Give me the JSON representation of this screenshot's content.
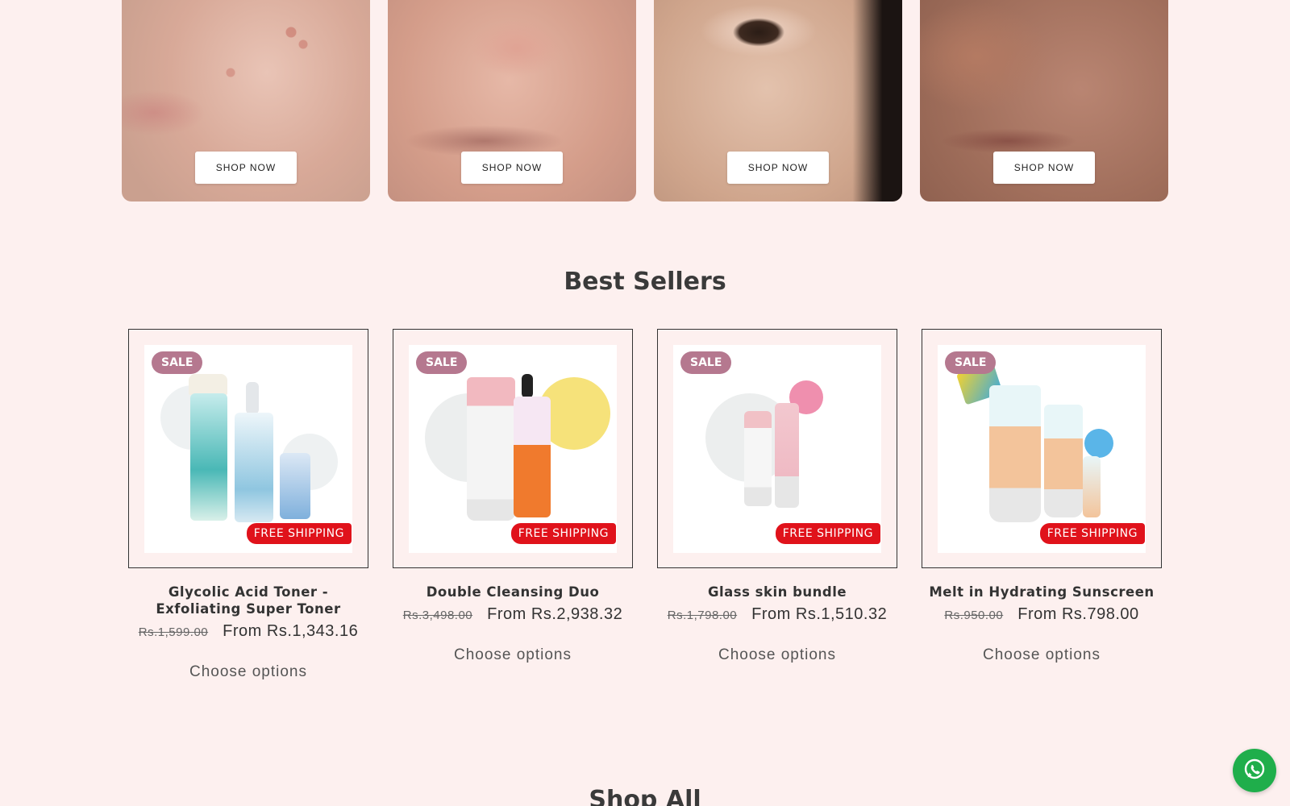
{
  "hero_tiles": [
    {
      "button_label": "SHOP NOW"
    },
    {
      "button_label": "SHOP NOW"
    },
    {
      "button_label": "SHOP NOW"
    },
    {
      "button_label": "SHOP NOW"
    }
  ],
  "best_sellers": {
    "title": "Best Sellers",
    "products": [
      {
        "badge": "SALE",
        "shipping_label": "FREE SHIPPING",
        "title": "Glycolic Acid Toner - Exfoliating Super Toner",
        "price_old": "Rs.1,599.00",
        "price_new": "From Rs.1,343.16",
        "action_label": "Choose options"
      },
      {
        "badge": "SALE",
        "shipping_label": "FREE SHIPPING",
        "title": "Double Cleansing Duo",
        "price_old": "Rs.3,498.00",
        "price_new": "From Rs.2,938.32",
        "action_label": "Choose options"
      },
      {
        "badge": "SALE",
        "shipping_label": "FREE SHIPPING",
        "title": "Glass skin bundle",
        "price_old": "Rs.1,798.00",
        "price_new": "From Rs.1,510.32",
        "action_label": "Choose options"
      },
      {
        "badge": "SALE",
        "shipping_label": "FREE SHIPPING",
        "title": "Melt in Hydrating Sunscreen",
        "price_old": "Rs.950.00",
        "price_new": "From Rs.798.00",
        "action_label": "Choose options"
      }
    ]
  },
  "shop_all": {
    "title": "Shop All"
  },
  "icons": {
    "chat": "whatsapp-icon"
  },
  "colors": {
    "background": "#fdf0ef",
    "sale_badge": "#b5788f",
    "free_shipping": "#e0121b",
    "whatsapp": "#1fae4b"
  }
}
